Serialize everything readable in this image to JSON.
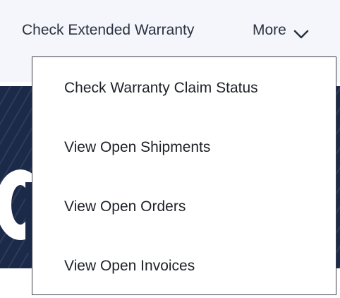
{
  "nav": {
    "extended_warranty_label": "Check Extended Warranty",
    "more_label": "More",
    "more_icon": "chevron-down-icon"
  },
  "dropdown": {
    "items": [
      {
        "label": "Check Warranty Claim Status"
      },
      {
        "label": "View Open Shipments"
      },
      {
        "label": "View Open Orders"
      },
      {
        "label": "View Open Invoices"
      }
    ]
  },
  "colors": {
    "nav_background": "#f4f6fb",
    "nav_text": "#2b3340",
    "hero_background": "#1c2a4a",
    "dropdown_border": "#3a3f47",
    "menu_text": "#1e2128"
  }
}
